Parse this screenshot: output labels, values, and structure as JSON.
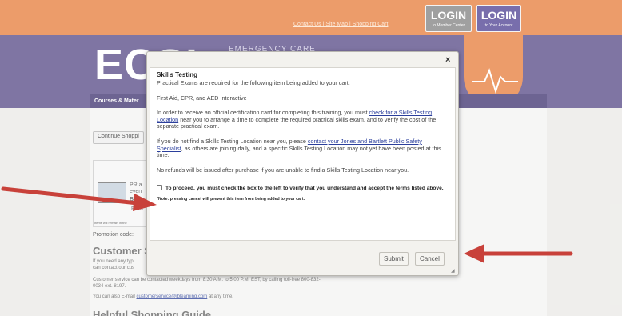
{
  "top_links": "Contact Us | Site Map | Shopping Cart",
  "login_member": {
    "label": "LOGIN",
    "sub": "to Member Center"
  },
  "login_account": {
    "label": "LOGIN",
    "sub": "to Your Account"
  },
  "logo_text": "ECSI",
  "logo_subtitle": "EMERGENCY CARE",
  "nav_left": "Courses & Mater",
  "nav_right": "r",
  "continue_shopping": "Continue Shoppi",
  "cart_lines": [
    "PR a",
    "even",
    "BN",
    "Rem"
  ],
  "cart_tiny": "Items will remain in the",
  "promotion": "Promotion code:",
  "customer_service": {
    "title": "Customer S",
    "line1": "If you need any typ",
    "line2": "can contact our cus",
    "line3": "Customer service can be contacted weekdays from 8:30 A.M. to 5:00 P.M. EST, by calling toll-free 800-832-",
    "line4": "0034 ext. 8197.",
    "line5_prefix": "You can also E-mail",
    "email": "customerservice@jblearning.com",
    "line5_suffix": "at any time."
  },
  "bottom_title": "Helpful Shopping Guide",
  "modal": {
    "close": "×",
    "title": "Skills Testing",
    "intro": "Practical Exams are required for the following item being added to your cart:",
    "item": "First Aid, CPR, and AED Interactive",
    "p1_a": "In order to receive an official certification card for completing this training, you must",
    "p1_link": "check for a Skills Testing Location",
    "p1_b": "near you to arrange a time to complete the required practical skills exam, and to verify the cost of the separate practical exam.",
    "p2_a": "If you do not find a Skills Testing Location near you, please",
    "p2_link": "contact your Jones and Bartlett Public Safety Specialist",
    "p2_b": ", as others are joining daily, and a specific Skills Testing Location may not yet have been posted at this time.",
    "p3": "No refunds will be issued after purchase if you are unable to find a Skills Testing Location near you.",
    "consent": "To proceed, you must check the box to the left to verify that you understand and accept the terms listed above.",
    "note": "*Note: pressing cancel will prevent this item from being added to your cart.",
    "submit": "Submit",
    "cancel": "Cancel"
  },
  "colors": {
    "top_bar": "#e8874a",
    "header": "#63578f",
    "arrow": "#c8413a",
    "link": "#2b3f9c"
  }
}
